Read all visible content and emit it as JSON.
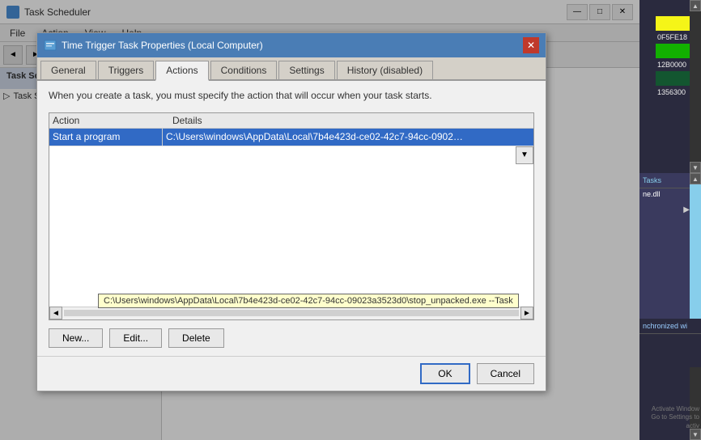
{
  "app": {
    "title": "Task Scheduler",
    "icon": "🗓",
    "menus": [
      "File",
      "Action",
      "View",
      "Help"
    ],
    "window_controls": [
      "—",
      "□",
      "✕"
    ]
  },
  "dialog": {
    "title": "Time Trigger Task Properties (Local Computer)",
    "tabs": [
      {
        "label": "General",
        "active": false
      },
      {
        "label": "Triggers",
        "active": false
      },
      {
        "label": "Actions",
        "active": true
      },
      {
        "label": "Conditions",
        "active": false
      },
      {
        "label": "Settings",
        "active": false
      },
      {
        "label": "History (disabled)",
        "active": false
      }
    ],
    "description": "When you create a task, you must specify the action that will occur when your task starts.",
    "table": {
      "columns": [
        "Action",
        "Details"
      ],
      "rows": [
        {
          "action": "Start a program",
          "details": "C:\\Users\\windows\\AppData\\Local\\7b4e423d-ce02-42c7-94cc-09023a3523d..."
        }
      ]
    },
    "tooltip": "C:\\Users\\windows\\AppData\\Local\\7b4e423d-ce02-42c7-94cc-09023a3523d0\\stop_unpacked.exe --Task",
    "buttons": {
      "new": "New...",
      "edit": "Edit...",
      "delete": "Delete"
    },
    "ok": "OK",
    "cancel": "Cancel"
  },
  "right_panel": {
    "colors": [
      "#f5f518",
      "#12b000",
      "#135630"
    ],
    "hex_values": [
      "0F5FE18",
      "12B0000",
      "1356300"
    ],
    "tasks_label": "Tasks",
    "task_item": "ne.dll",
    "synchronized_text": "nchronized wi",
    "activate_text": "Activate Window\nGo to Settings to activ"
  },
  "scrollbar": {
    "left_arrow": "◄",
    "right_arrow": "►",
    "up_arrow": "▲",
    "down_arrow": "▼"
  }
}
